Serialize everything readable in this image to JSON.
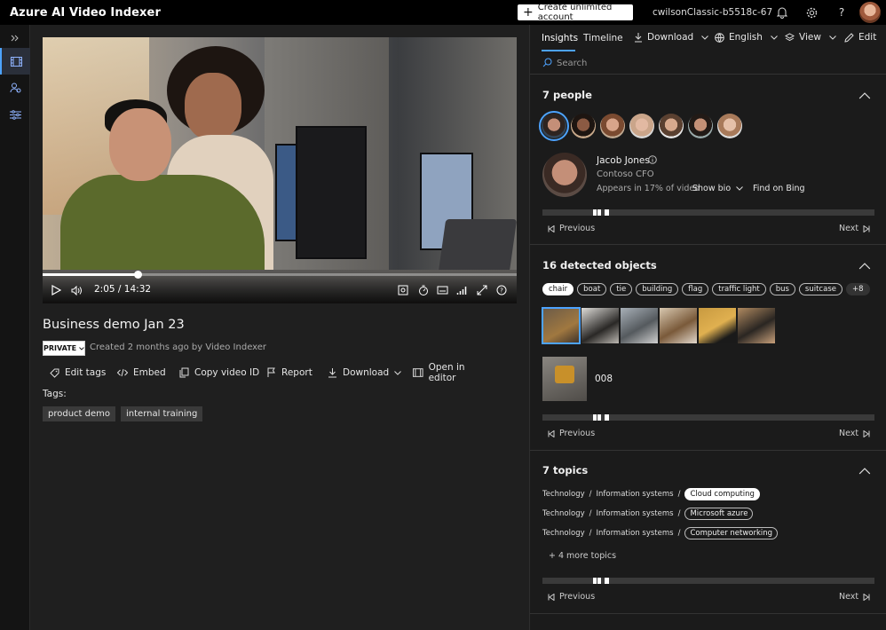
{
  "app": {
    "title": "Azure AI Video Indexer"
  },
  "topbar": {
    "create_label": "Create unlimited account",
    "account_name": "cwilsonClassic-b5518c-67"
  },
  "video": {
    "time": "2:05 / 14:32",
    "progress": 0.2,
    "title": "Business demo Jan 23",
    "visibility": "PRIVATE",
    "created": "Created 2 months ago by Video Indexer",
    "actions": [
      "Edit tags",
      "Embed",
      "Copy video ID",
      "Report",
      "Download",
      "Open in editor"
    ],
    "tags_label": "Tags:",
    "tags": [
      "product demo",
      "internal training"
    ]
  },
  "panel": {
    "tabs": [
      "Insights",
      "Timeline"
    ],
    "download": "Download",
    "language": "English",
    "view": "View",
    "edit": "Edit",
    "search_placeholder": "Search",
    "people": {
      "title": "7 people",
      "name": "Jacob Jones",
      "role": "Contoso CFO",
      "appears": "Appears in 17% of video",
      "show_bio": "Show bio",
      "find": "Find on Bing"
    },
    "objects": {
      "title": "16 detected objects",
      "chips": [
        "chair",
        "boat",
        "tie",
        "building",
        "flag",
        "traffic light",
        "bus",
        "suitcase",
        "+8"
      ],
      "selected_id": "008"
    },
    "topics": {
      "title": "7 topics",
      "rows": [
        {
          "path1": "Technology",
          "path2": "Information systems",
          "topic": "Cloud computing"
        },
        {
          "path1": "Technology",
          "path2": "Information systems",
          "topic": "Microsoft azure"
        },
        {
          "path1": "Technology",
          "path2": "Information systems",
          "topic": "Computer networking"
        }
      ],
      "more": "+ 4 more topics"
    },
    "nav": {
      "previous": "Previous",
      "next": "Next"
    }
  },
  "colors": {
    "accent": "#4da3ff",
    "background": "#1b1b1b"
  }
}
